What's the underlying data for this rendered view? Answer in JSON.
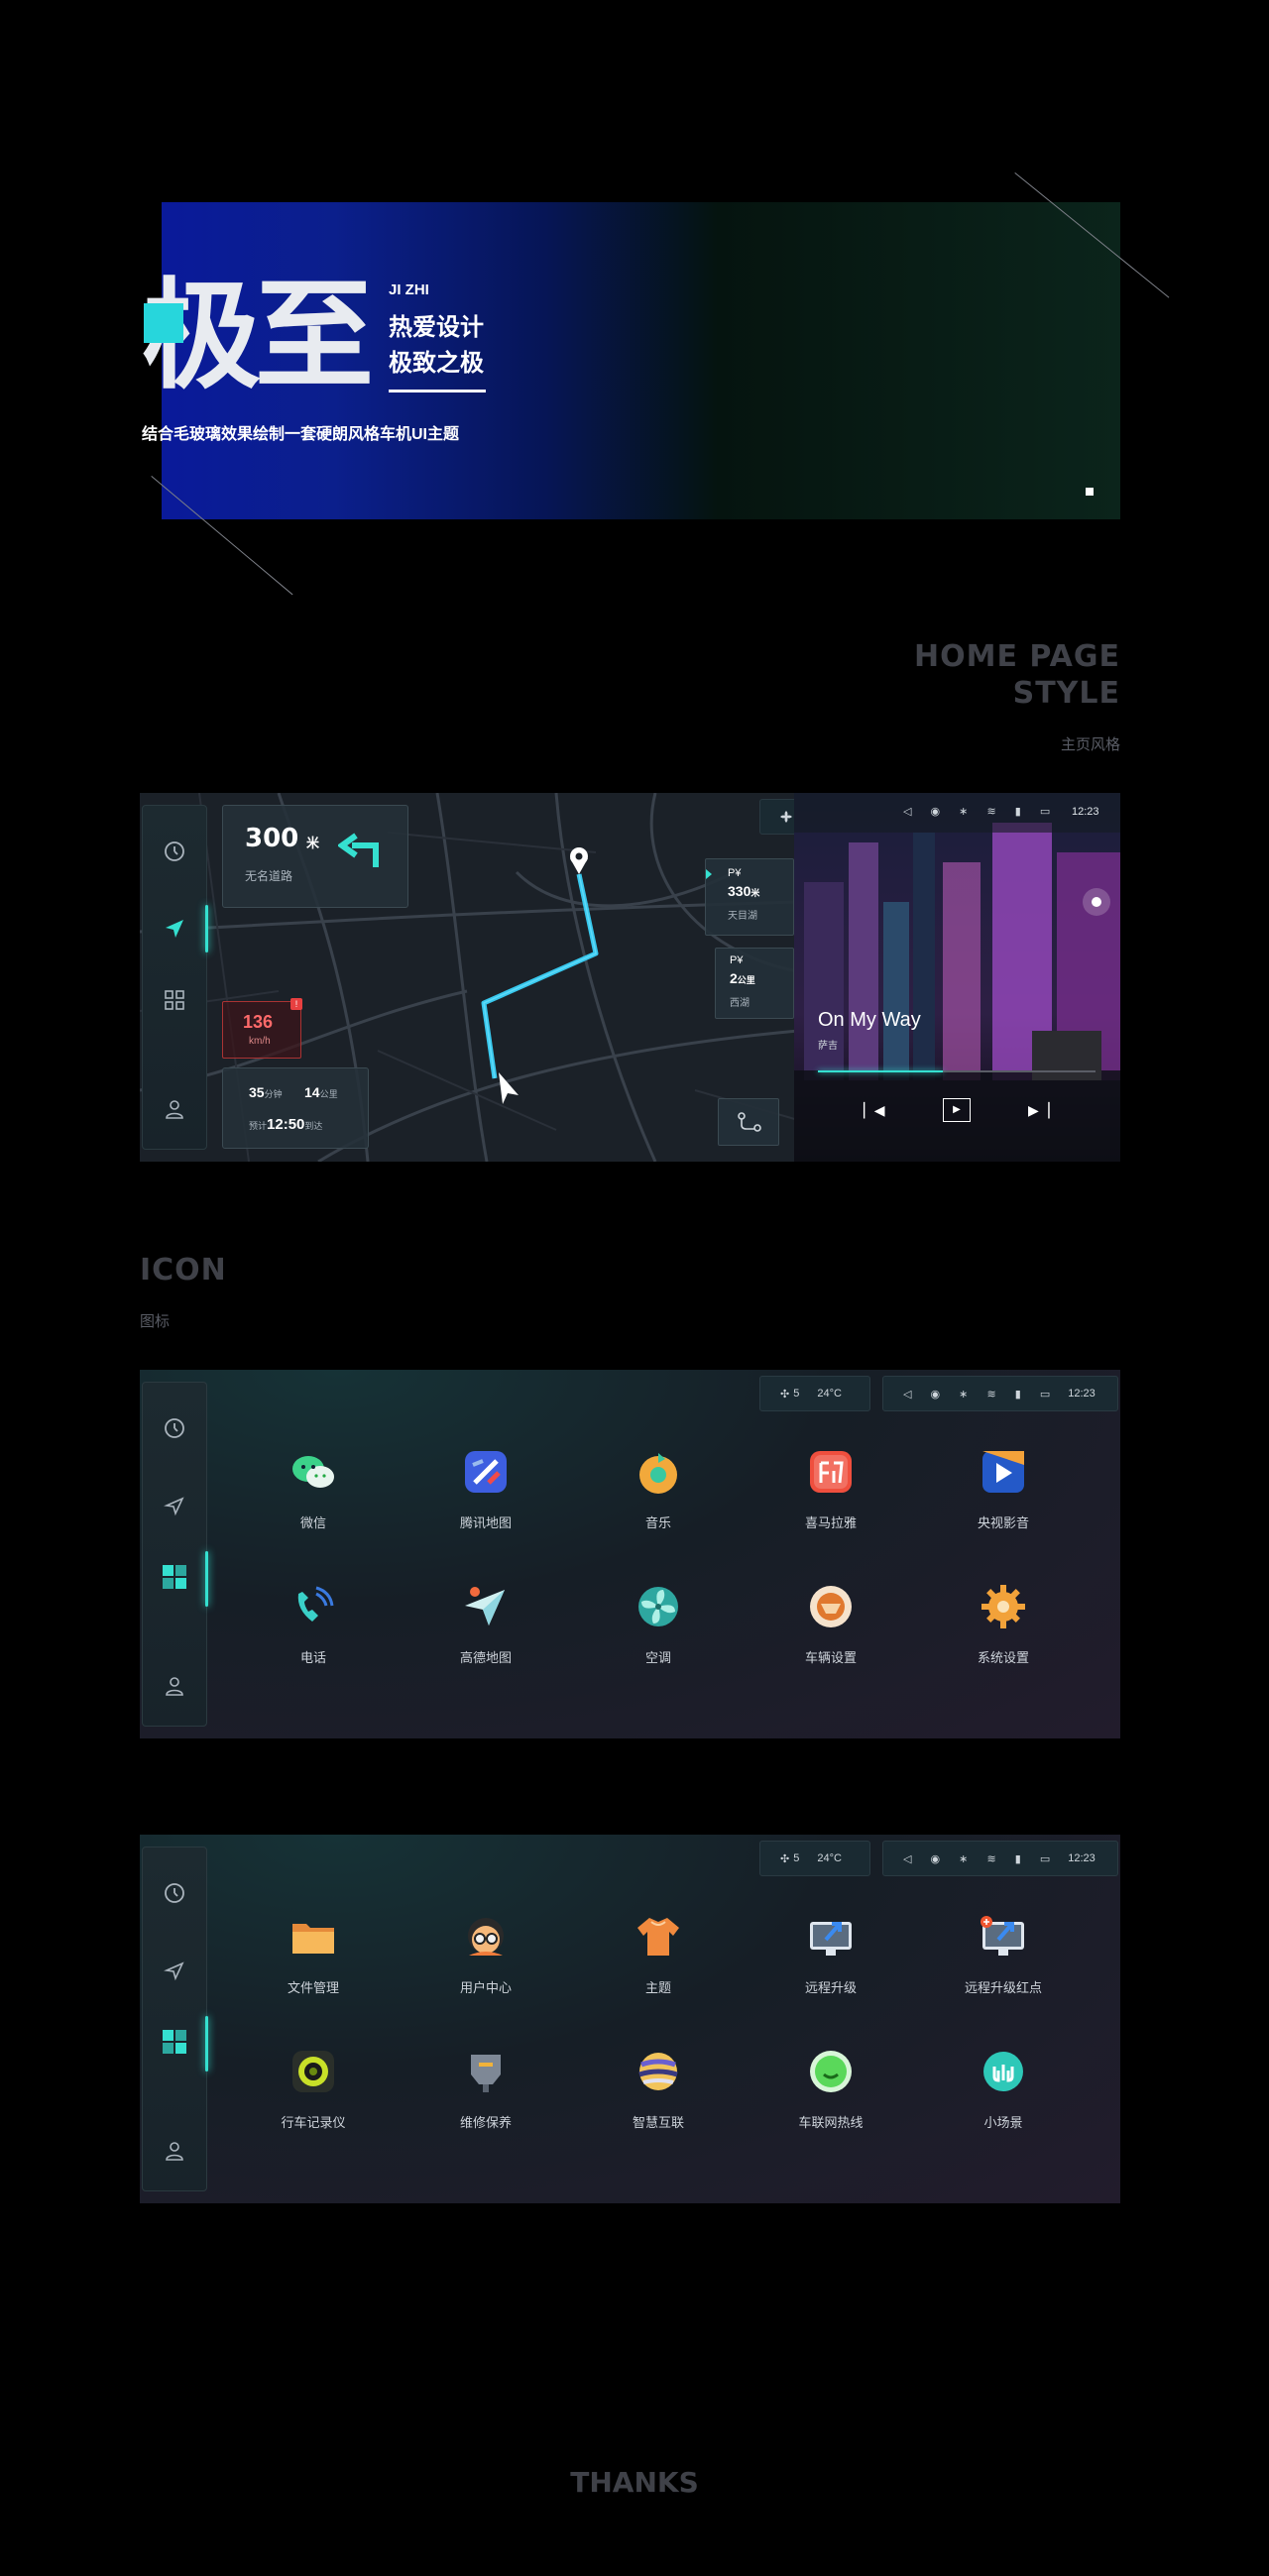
{
  "hero": {
    "title": "极至",
    "subtitle_en": "JI ZHI",
    "subtitle_line1": "热爱设计",
    "subtitle_line2": "极致之极",
    "description": "结合毛玻璃效果绘制一套硬朗风格车机UI主题"
  },
  "section_home": {
    "title_line1": "HOME PAGE",
    "title_line2": "STYLE",
    "subtitle": "主页风格"
  },
  "home_ui": {
    "turn_distance": "300",
    "turn_unit": "米",
    "road_name": "无名道路",
    "speed_value": "136",
    "speed_unit": "km/h",
    "trip_minutes": "35",
    "trip_minutes_unit": "分钟",
    "trip_km": "14",
    "trip_km_unit": "公里",
    "eta_prefix": "预计",
    "eta_time": "12:50",
    "eta_suffix": "到达",
    "parking1_label": "P¥",
    "parking1_distance": "330",
    "parking1_unit": "米",
    "parking1_name": "天目湖",
    "parking2_label": "P¥",
    "parking2_distance": "2",
    "parking2_unit": "公里",
    "parking2_name": "西湖",
    "fan_level": "5",
    "temperature": "24°C",
    "clock": "12:23",
    "song_title": "On My Way",
    "song_artist": "萨吉"
  },
  "section_icon": {
    "title": "ICON",
    "subtitle": "图标"
  },
  "icon_page1": {
    "apps": [
      {
        "label": "微信",
        "icon": "wechat-icon"
      },
      {
        "label": "腾讯地图",
        "icon": "tencent-map-icon"
      },
      {
        "label": "音乐",
        "icon": "music-icon"
      },
      {
        "label": "喜马拉雅",
        "icon": "ximalaya-icon"
      },
      {
        "label": "央视影音",
        "icon": "cctv-video-icon"
      },
      {
        "label": "电话",
        "icon": "phone-icon"
      },
      {
        "label": "高德地图",
        "icon": "amap-icon"
      },
      {
        "label": "空调",
        "icon": "air-conditioner-icon"
      },
      {
        "label": "车辆设置",
        "icon": "vehicle-settings-icon"
      },
      {
        "label": "系统设置",
        "icon": "system-settings-icon"
      }
    ]
  },
  "icon_page2": {
    "apps": [
      {
        "label": "文件管理",
        "icon": "folder-icon"
      },
      {
        "label": "用户中心",
        "icon": "user-center-icon"
      },
      {
        "label": "主题",
        "icon": "theme-shirt-icon"
      },
      {
        "label": "远程升级",
        "icon": "remote-upgrade-icon"
      },
      {
        "label": "远程升级红点",
        "icon": "remote-upgrade-badge-icon"
      },
      {
        "label": "行车记录仪",
        "icon": "dashcam-icon"
      },
      {
        "label": "维修保养",
        "icon": "maintenance-icon"
      },
      {
        "label": "智慧互联",
        "icon": "smart-connect-icon"
      },
      {
        "label": "车联网热线",
        "icon": "hotline-icon"
      },
      {
        "label": "小场景",
        "icon": "mini-scene-icon"
      }
    ]
  },
  "footer": {
    "thanks": "THANKS"
  },
  "colors": {
    "accent": "#35e0d0",
    "hero_blue": "#0b1f8c",
    "warning": "#e84040"
  }
}
